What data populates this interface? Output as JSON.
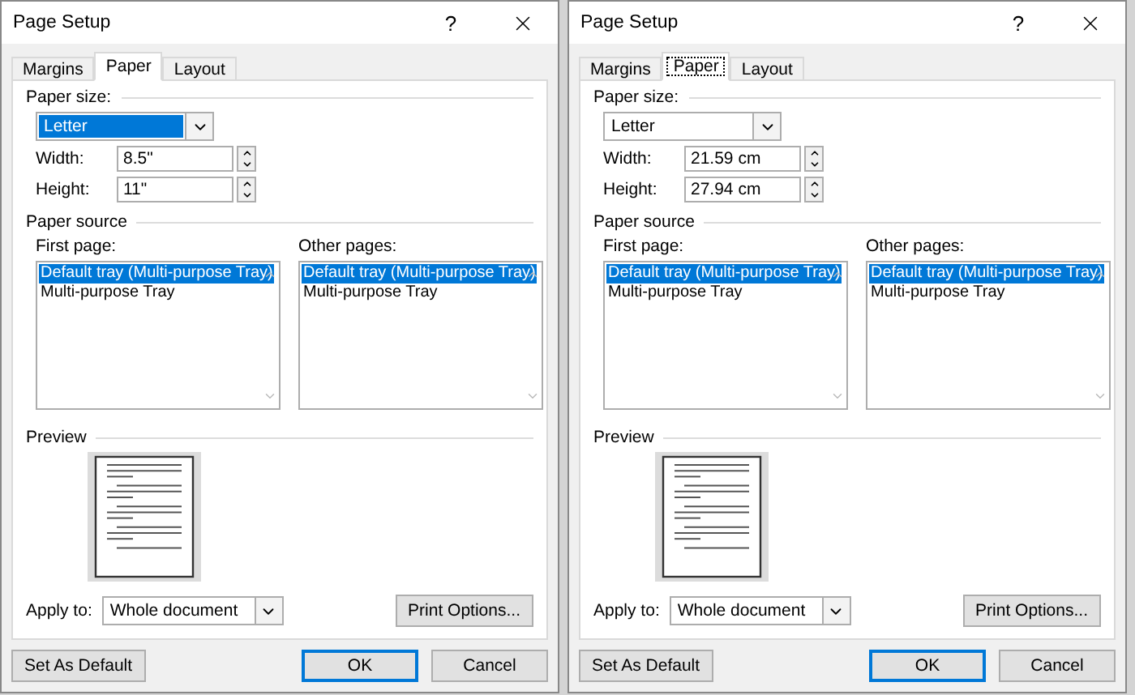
{
  "dialogs": [
    {
      "title": "Page Setup",
      "help": "?",
      "tabs": [
        {
          "label": "Margins",
          "selected": false,
          "focused": false
        },
        {
          "label": "Paper",
          "selected": true,
          "focused": false
        },
        {
          "label": "Layout",
          "selected": false,
          "focused": false
        }
      ],
      "paper_size": {
        "label": "Paper size:",
        "value": "Letter",
        "focused": true
      },
      "width": {
        "label": "Width:",
        "value": "8.5\""
      },
      "height": {
        "label": "Height:",
        "value": "11\""
      },
      "paper_source": {
        "label": "Paper source",
        "lists": [
          {
            "label": "First page:",
            "items": [
              {
                "text": "Default tray (Multi-purpose Tray)",
                "selected": true
              },
              {
                "text": "Multi-purpose Tray",
                "selected": false
              }
            ]
          },
          {
            "label": "Other pages:",
            "items": [
              {
                "text": "Default tray (Multi-purpose Tray)",
                "selected": true
              },
              {
                "text": "Multi-purpose Tray",
                "selected": false
              }
            ]
          }
        ]
      },
      "preview": {
        "label": "Preview"
      },
      "apply_to": {
        "label": "Apply to:",
        "value": "Whole document"
      },
      "print_options": "Print Options...",
      "buttons": [
        {
          "label": "Set As Default",
          "default": false,
          "kind": "left"
        },
        {
          "label": "OK",
          "default": true,
          "kind": "right"
        },
        {
          "label": "Cancel",
          "default": false,
          "kind": "right"
        }
      ]
    },
    {
      "title": "Page Setup",
      "help": "?",
      "tabs": [
        {
          "label": "Margins",
          "selected": false,
          "focused": false
        },
        {
          "label": "Paper",
          "selected": true,
          "focused": true
        },
        {
          "label": "Layout",
          "selected": false,
          "focused": false
        }
      ],
      "paper_size": {
        "label": "Paper size:",
        "value": "Letter",
        "focused": false
      },
      "width": {
        "label": "Width:",
        "value": "21.59 cm"
      },
      "height": {
        "label": "Height:",
        "value": "27.94 cm"
      },
      "paper_source": {
        "label": "Paper source",
        "lists": [
          {
            "label": "First page:",
            "items": [
              {
                "text": "Default tray (Multi-purpose Tray)",
                "selected": true
              },
              {
                "text": "Multi-purpose Tray",
                "selected": false
              }
            ]
          },
          {
            "label": "Other pages:",
            "items": [
              {
                "text": "Default tray (Multi-purpose Tray)",
                "selected": true
              },
              {
                "text": "Multi-purpose Tray",
                "selected": false
              }
            ]
          }
        ]
      },
      "preview": {
        "label": "Preview"
      },
      "apply_to": {
        "label": "Apply to:",
        "value": "Whole document"
      },
      "print_options": "Print Options...",
      "buttons": [
        {
          "label": "Set As Default",
          "default": false,
          "kind": "left"
        },
        {
          "label": "OK",
          "default": true,
          "kind": "right"
        },
        {
          "label": "Cancel",
          "default": false,
          "kind": "right"
        }
      ]
    }
  ]
}
